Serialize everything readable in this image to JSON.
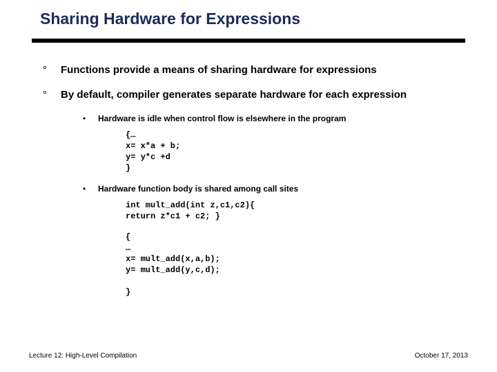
{
  "title": "Sharing Hardware for Expressions",
  "bullets": [
    {
      "mark": "°",
      "text": "Functions provide a means of sharing hardware for expressions"
    },
    {
      "mark": "°",
      "text": "By default, compiler generates separate hardware for each expression"
    }
  ],
  "subs": [
    {
      "mark": "•",
      "text": "Hardware is idle when control flow is elsewhere in the program"
    },
    {
      "mark": "•",
      "text": "Hardware function body is shared among call sites"
    }
  ],
  "code1": "{…\nx= x*a + b;\ny= y*c +d\n}",
  "code2": "int mult_add(int z,c1,c2){\nreturn z*c1 + c2; }",
  "code3": "{\n…\nx= mult_add(x,a,b);\ny= mult_add(y,c,d);\n\n}",
  "footer": {
    "left": "Lecture 12: High-Level Compilation",
    "right": "October 17, 2013"
  }
}
